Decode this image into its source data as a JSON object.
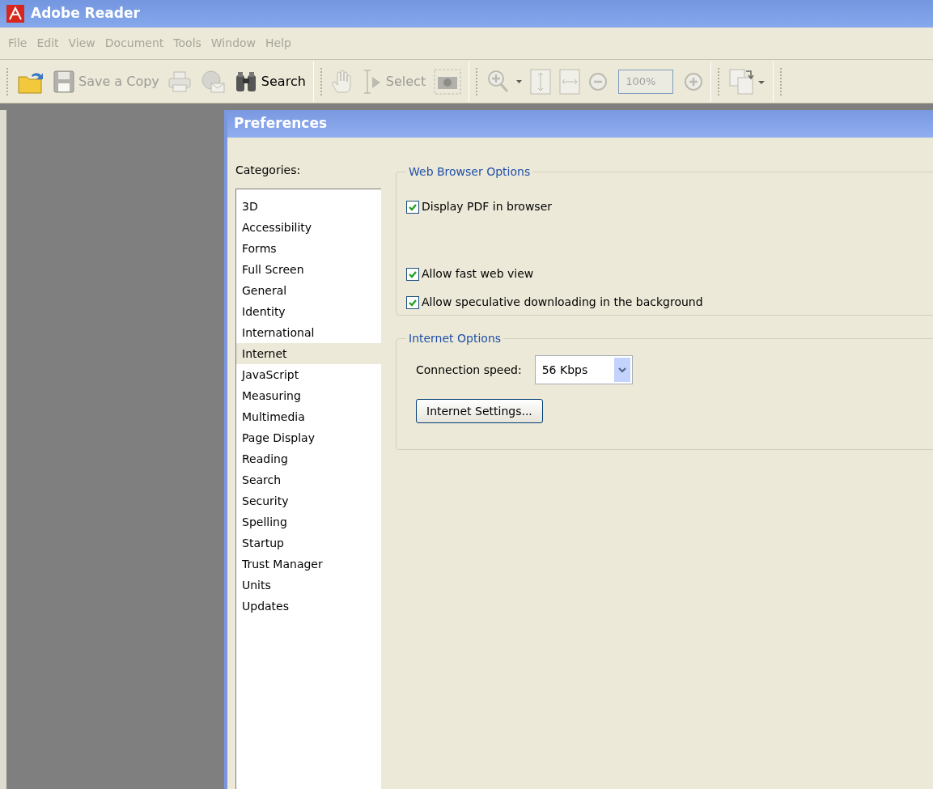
{
  "window": {
    "title": "Adobe Reader"
  },
  "menu": [
    {
      "label": "File",
      "disabled": true
    },
    {
      "label": "Edit",
      "disabled": true
    },
    {
      "label": "View",
      "disabled": true
    },
    {
      "label": "Document",
      "disabled": true
    },
    {
      "label": "Tools",
      "disabled": true
    },
    {
      "label": "Window",
      "disabled": true
    },
    {
      "label": "Help",
      "disabled": true
    }
  ],
  "toolbar": [
    {
      "kind": "open",
      "disabled": false
    },
    {
      "kind": "save",
      "label": "Save a Copy",
      "disabled": true
    },
    {
      "kind": "print",
      "disabled": true
    },
    {
      "kind": "email",
      "disabled": true
    },
    {
      "kind": "search",
      "label": "Search",
      "disabled": false
    },
    {
      "kind": "separator"
    },
    {
      "kind": "hand",
      "disabled": true
    },
    {
      "kind": "select",
      "label": "Select",
      "disabled": true
    },
    {
      "kind": "snapshot",
      "disabled": true
    },
    {
      "kind": "separator"
    },
    {
      "kind": "zoom-in",
      "disabled": true
    },
    {
      "kind": "fit-page",
      "disabled": true
    },
    {
      "kind": "fit-width",
      "disabled": true
    },
    {
      "kind": "minus",
      "disabled": true
    },
    {
      "kind": "zoom-field",
      "value": "100%",
      "disabled": true
    },
    {
      "kind": "plus",
      "disabled": true
    },
    {
      "kind": "separator"
    },
    {
      "kind": "rotate",
      "disabled": true
    },
    {
      "kind": "separator"
    }
  ],
  "dialog": {
    "title": "Preferences",
    "categories_label": "Categories:",
    "categories": [
      {
        "label": "3D",
        "selected": false
      },
      {
        "label": "Accessibility",
        "selected": false
      },
      {
        "label": "Forms",
        "selected": false
      },
      {
        "label": "Full Screen",
        "selected": false
      },
      {
        "label": "General",
        "selected": false
      },
      {
        "label": "Identity",
        "selected": false
      },
      {
        "label": "International",
        "selected": false
      },
      {
        "label": "Internet",
        "selected": true
      },
      {
        "label": "JavaScript",
        "selected": false
      },
      {
        "label": "Measuring",
        "selected": false
      },
      {
        "label": "Multimedia",
        "selected": false
      },
      {
        "label": "Page Display",
        "selected": false
      },
      {
        "label": "Reading",
        "selected": false
      },
      {
        "label": "Search",
        "selected": false
      },
      {
        "label": "Security",
        "selected": false
      },
      {
        "label": "Spelling",
        "selected": false
      },
      {
        "label": "Startup",
        "selected": false
      },
      {
        "label": "Trust Manager",
        "selected": false
      },
      {
        "label": "Units",
        "selected": false
      },
      {
        "label": "Updates",
        "selected": false
      }
    ],
    "web_browser_options": {
      "title": "Web Browser Options",
      "options": [
        {
          "label": "Display PDF in browser",
          "checked": true
        },
        {
          "label": "Allow fast web view",
          "checked": true
        },
        {
          "label": "Allow speculative downloading in the background",
          "checked": true
        }
      ]
    },
    "internet_options": {
      "title": "Internet Options",
      "connection_speed_label": "Connection speed:",
      "connection_speed": "56 Kbps",
      "settings_button": "Internet Settings..."
    }
  }
}
